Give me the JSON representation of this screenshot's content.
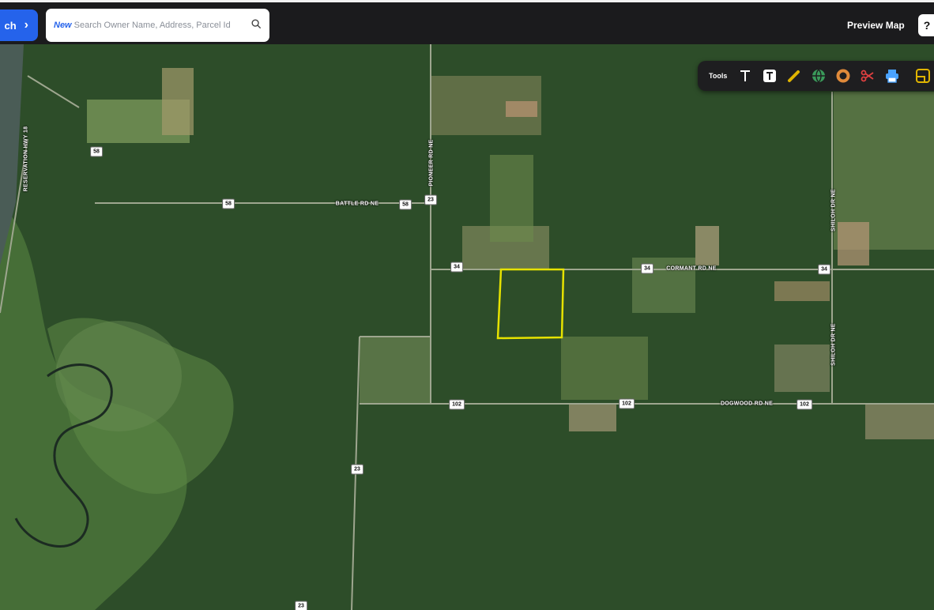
{
  "header": {
    "search_button_label": "ch",
    "search_new_tag": "New",
    "search_placeholder": "Search Owner Name, Address, Parcel Id",
    "preview_map_label": "Preview Map",
    "help_label": "?"
  },
  "toolbar": {
    "label": "Tools",
    "tools": [
      "text-tool-icon",
      "text-box-tool-icon",
      "pencil-tool-icon",
      "globe-tool-icon",
      "donut-tool-icon",
      "scissors-tool-icon",
      "print-tool-icon",
      "layout-tool-icon"
    ]
  },
  "map": {
    "parcel_highlight_color": "#e6e200",
    "shields": {
      "s58a": "58",
      "s58b": "58",
      "s58c": "58",
      "s23a": "23",
      "s23b": "23",
      "s23c": "23",
      "s34a": "34",
      "s34b": "34",
      "s34c": "34",
      "s102a": "102",
      "s102b": "102",
      "s102c": "102"
    },
    "road_labels": {
      "battle": "BATTLE RD NE",
      "cormant": "CORMANT RD NE",
      "dogwood": "DOGWOOD RD NE",
      "pioneer": "PIONEER RD NE",
      "shiloh1": "SHILOH DR NE",
      "shiloh2": "SHILOH DR NE",
      "reservation": "RESERVATION HWY 18"
    }
  }
}
